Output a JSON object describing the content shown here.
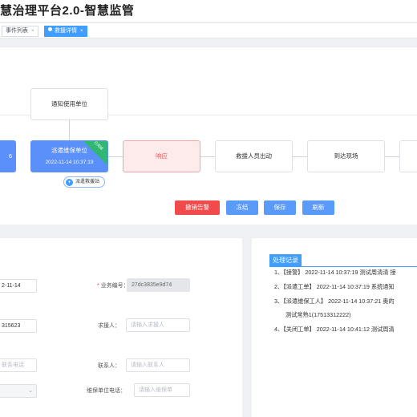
{
  "header": {
    "title": "慧治理平台2.0-智慧监管"
  },
  "tabs": [
    {
      "label": "事件列表",
      "close": "×"
    },
    {
      "label": "救援详情",
      "close": "×"
    }
  ],
  "flow": {
    "left_node_text": "6",
    "notify_node": "通知使用单位",
    "dispatch_node": {
      "label": "派遣维保单位",
      "time": "2022-11-14 10:37:19",
      "ribbon": "已完成"
    },
    "respond_node": "响应",
    "rescuer_node": "救援人员出动",
    "arrive_node": "到达现场",
    "station_tag": "派遣救援站",
    "station_icon": "plus-icon"
  },
  "actions": {
    "revoke": "撤销告警",
    "freeze": "冻结",
    "save": "保存",
    "refresh": "刷新"
  },
  "form": {
    "date_value": "2-11-14",
    "business_no_label": "业务编号：",
    "business_no_value": "27dc3835e9d74",
    "phone_value": "315623",
    "requester_label": "求援人：",
    "requester_placeholder": "请输入求援人",
    "contact_phone_placeholder": "联系电话",
    "contact_label": "联系人：",
    "contact_placeholder": "请输入联系人",
    "maint_phone_label": "维保单位电话：",
    "maint_phone_placeholder": "请输入维保单"
  },
  "records": {
    "title": "处理记录",
    "items": [
      "1、【接警】 2022-11-14 10:37:19 测试周清清 接",
      "2、【派遣工单】 2022-11-14 10:37:19 系统通知",
      "3、【派遣维保工人】 2022-11-14 10:37:21 奥的",
      "测试常熟1(17513312222)",
      "4、【关闭工单】 2022-11-14 10:41:12 测试周清"
    ]
  },
  "colors": {
    "primary": "#409eff",
    "danger": "#f04a4a",
    "success": "#2eb872"
  }
}
